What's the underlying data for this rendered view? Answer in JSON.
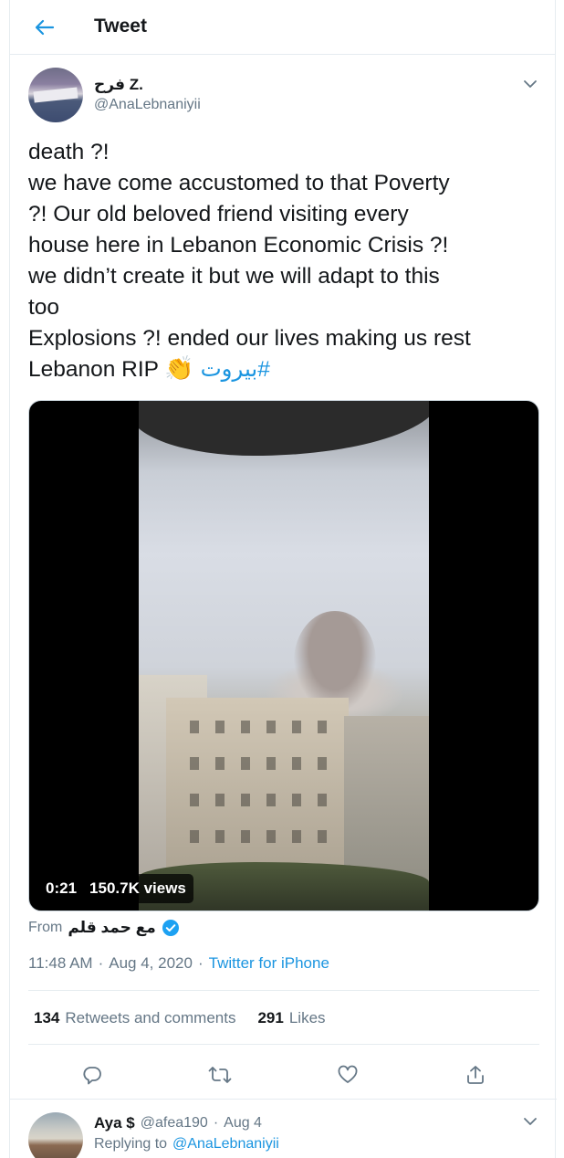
{
  "header": {
    "title": "Tweet",
    "back_icon": "back-arrow-icon"
  },
  "colors": {
    "accent": "#1b95e0",
    "text_primary": "#14171a",
    "text_secondary": "#657786",
    "border": "#e6ecf0",
    "verified": "#1da1f2"
  },
  "tweet": {
    "author": {
      "name": "فرح Z.",
      "handle": "@AnaLebnaniyii"
    },
    "text_lines": [
      "death ?!",
      "we have come accustomed  to that Poverty",
      "?! Our old beloved friend visiting every",
      "house here in Lebanon Economic Crisis ?!",
      "we didn’t create it but we will adapt to this",
      "too",
      "Explosions ?! ended our lives making us rest"
    ],
    "last_line_text": "Lebanon RIP",
    "emoji": "👏",
    "hashtag": "#بيروت",
    "video": {
      "duration": "0:21",
      "views": "150.7K views"
    },
    "from_label": "From",
    "from_name": "مع حمد قلم",
    "time": "11:48 AM",
    "date": "Aug 4, 2020",
    "source": "Twitter for iPhone",
    "separator": "·",
    "stats": {
      "retweets_count": "134",
      "retweets_label": "Retweets and comments",
      "likes_count": "291",
      "likes_label": "Likes"
    },
    "actions": [
      "reply-icon",
      "retweet-icon",
      "like-icon",
      "share-icon"
    ]
  },
  "reply": {
    "name": "Aya $",
    "handle": "@afea190",
    "date": "Aug 4",
    "replying_to_label": "Replying to",
    "replying_to_handle": "@AnaLebnaniyii"
  }
}
